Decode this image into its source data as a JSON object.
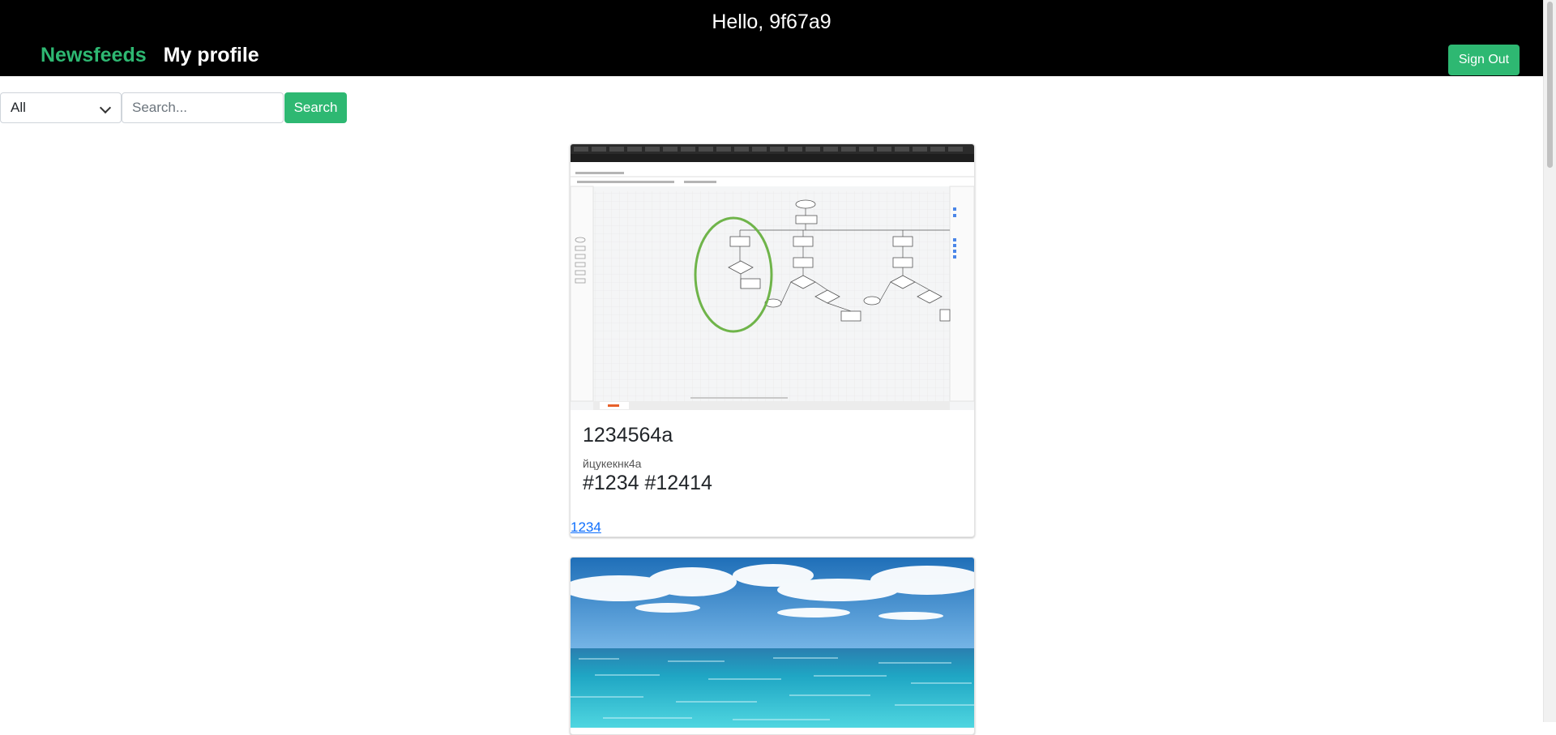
{
  "header": {
    "greeting": "Hello, 9f67a9",
    "nav": [
      {
        "label": "Newsfeeds",
        "active": true
      },
      {
        "label": "My profile",
        "active": false
      }
    ],
    "sign_out_label": "Sign Out",
    "accent_color": "#2eb872"
  },
  "search": {
    "filter_value": "All",
    "placeholder": "Search...",
    "button_label": "Search"
  },
  "posts": [
    {
      "image_icon": "diagram-screenshot-image",
      "title": "1234564a",
      "text": "йцукекнк4а",
      "tags": "#1234 #12414",
      "link": "1234"
    },
    {
      "image_icon": "ocean-photo-image"
    }
  ]
}
